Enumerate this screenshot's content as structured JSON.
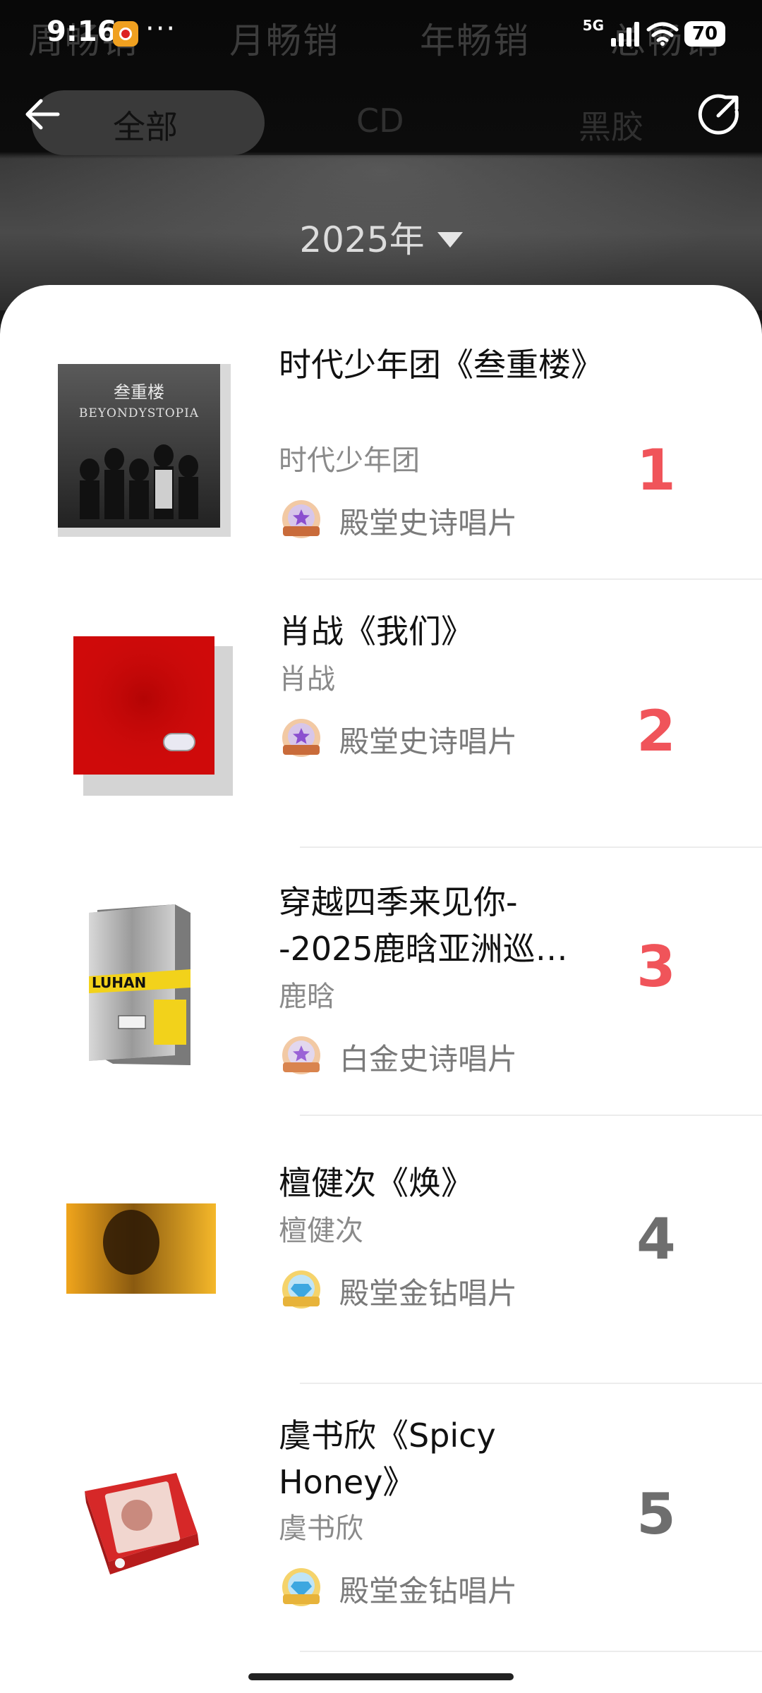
{
  "status_bar": {
    "time": "9:16",
    "more": "···",
    "network": "5G",
    "battery": "70"
  },
  "ranking_tabs": [
    "周畅销",
    "月畅销",
    "年畅销",
    "总畅销"
  ],
  "nav": {
    "filters": [
      "全部",
      "CD",
      "黑胶"
    ],
    "active_filter": "全部"
  },
  "year_selector": {
    "label": "2025年"
  },
  "items": [
    {
      "rank": "1",
      "title": "时代少年团《叁重楼》",
      "artist": "时代少年团",
      "badge": "殿堂史诗唱片",
      "badge_icon": "epic-medal-icon",
      "cover_text": "叁重楼",
      "cover_sub": "BEYONDYSTOPIA"
    },
    {
      "rank": "2",
      "title": "肖战《我们》",
      "artist": "肖战",
      "badge": "殿堂史诗唱片",
      "badge_icon": "epic-medal-icon"
    },
    {
      "rank": "3",
      "title": "穿越四季来见你--2025鹿晗亚洲巡…",
      "artist": "鹿晗",
      "badge": "白金史诗唱片",
      "badge_icon": "epic-medal-icon",
      "cover_text": "LUHAN"
    },
    {
      "rank": "4",
      "title": "檀健次《焕》",
      "artist": "檀健次",
      "badge": "殿堂金钻唱片",
      "badge_icon": "diamond-medal-icon"
    },
    {
      "rank": "5",
      "title": "虞书欣《Spicy Honey》",
      "artist": "虞书欣",
      "badge": "殿堂金钻唱片",
      "badge_icon": "diamond-medal-icon"
    }
  ],
  "colors": {
    "rank_top3": "#f0545a",
    "rank_other": "#6e6e6e",
    "header_bg": "#0a0a0a",
    "card_bg": "#ffffff"
  }
}
